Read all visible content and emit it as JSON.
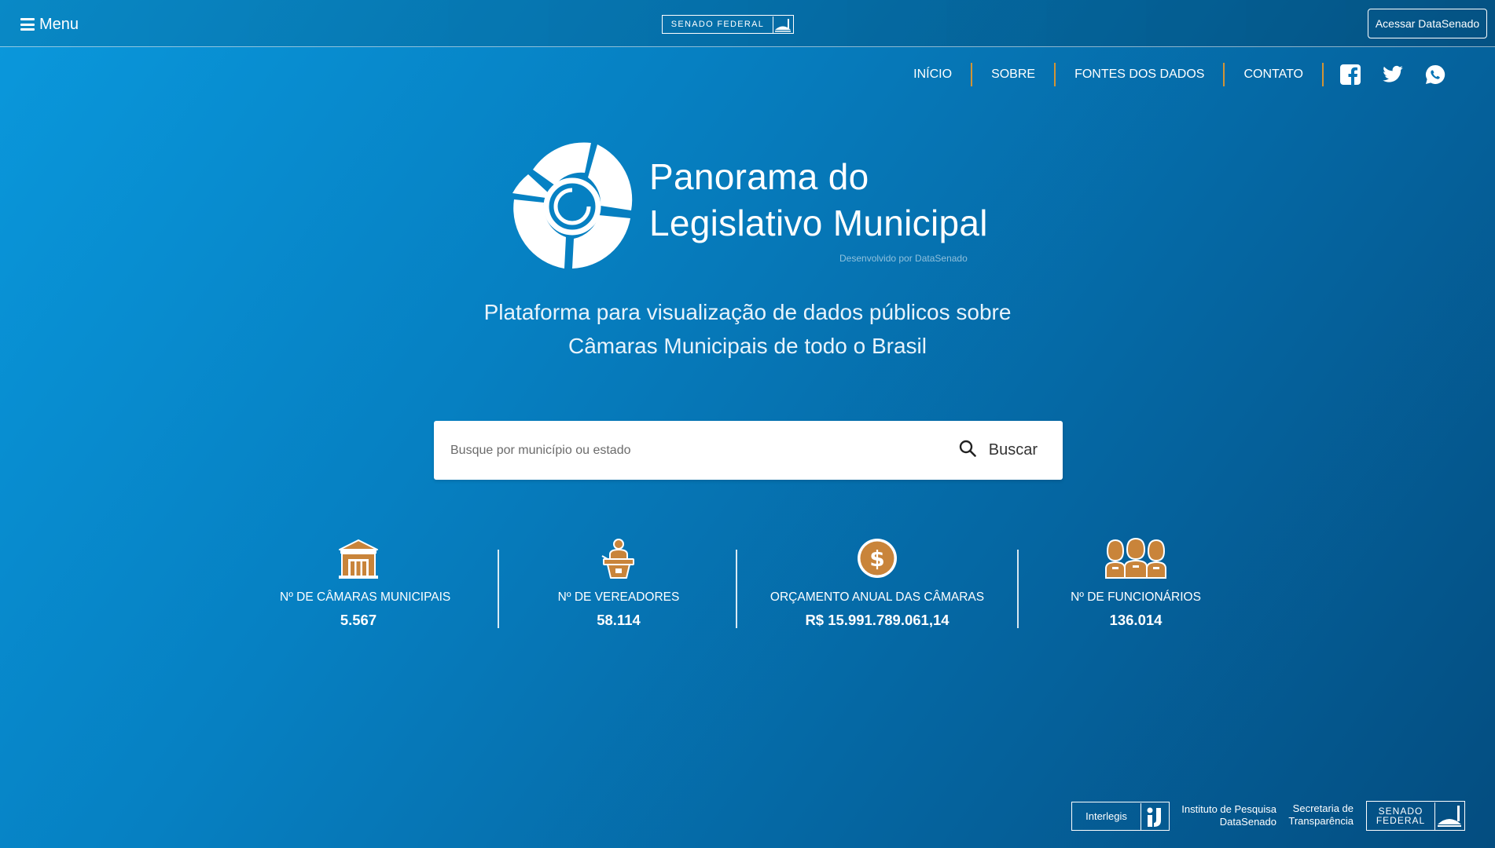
{
  "header": {
    "menu_label": "Menu",
    "brand": "SENADO FEDERAL",
    "access_button": "Acessar DataSenado"
  },
  "nav": {
    "items": [
      {
        "label": "INÍCIO"
      },
      {
        "label": "SOBRE"
      },
      {
        "label": "FONTES DOS DADOS"
      },
      {
        "label": "CONTATO"
      }
    ],
    "social": [
      "facebook-icon",
      "twitter-icon",
      "whatsapp-icon"
    ]
  },
  "hero": {
    "title_line1": "Panorama do",
    "title_line2": "Legislativo Municipal",
    "developed_by": "Desenvolvido por DataSenado",
    "subtitle_line1": "Plataforma para visualização de dados públicos sobre",
    "subtitle_line2": "Câmaras Municipais de todo o Brasil"
  },
  "search": {
    "placeholder": "Busque por município ou estado",
    "value": "",
    "button_label": "Buscar"
  },
  "stats": [
    {
      "icon": "building-icon",
      "label": "Nº DE CÂMARAS MUNICIPAIS",
      "value": "5.567"
    },
    {
      "icon": "speaker-podium-icon",
      "label": "Nº DE VEREADORES",
      "value": "58.114"
    },
    {
      "icon": "dollar-coin-icon",
      "label": "ORÇAMENTO ANUAL DAS CÂMARAS",
      "value": "R$ 15.991.789.061,14"
    },
    {
      "icon": "people-group-icon",
      "label": "Nº DE FUNCIONÁRIOS",
      "value": "136.014"
    }
  ],
  "footer": {
    "interlegis": "Interlegis",
    "instituto_line1": "Instituto de Pesquisa",
    "instituto_line2": "DataSenado",
    "secretaria_line1": "Secretaria de",
    "secretaria_line2": "Transparência",
    "senado_line1": "SENADO",
    "senado_line2": "FEDERAL"
  },
  "colors": {
    "accent": "#d29435",
    "icon_orange": "#c9843a",
    "background_start": "#0a98dc",
    "background_end": "#044d80"
  }
}
